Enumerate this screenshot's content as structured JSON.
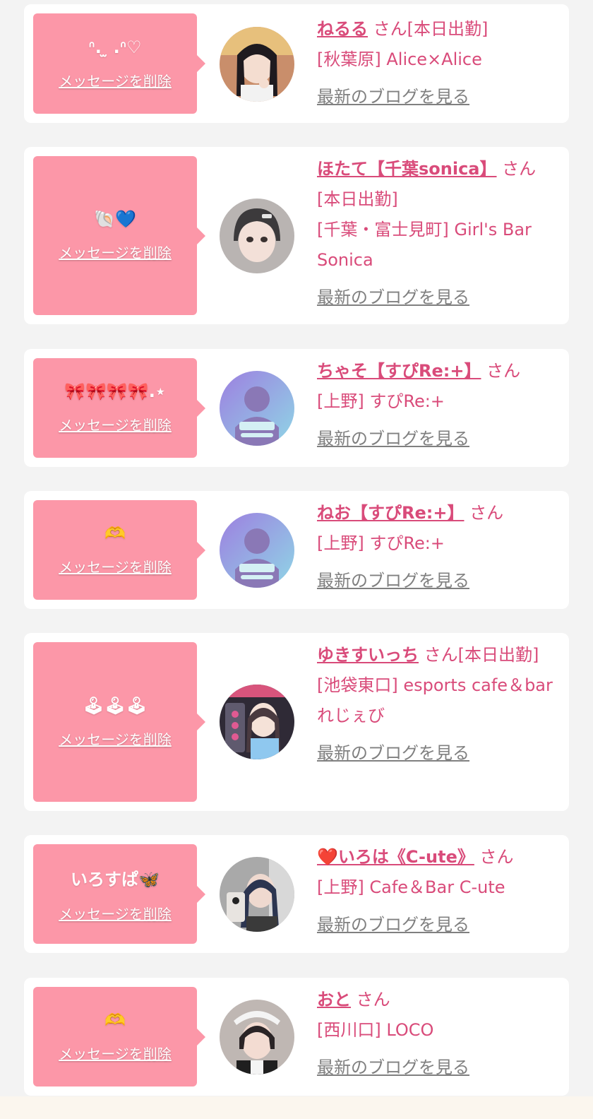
{
  "delete_label": "メッセージを削除",
  "blog_label": "最新のブログを見る",
  "items": [
    {
      "message": "ᐢ. ̫ .ᐢ♡",
      "name": "ねるる",
      "suffix": "さん[本日出勤]",
      "shop": "[秋葉原] Alice×Alice",
      "avatar": "photo"
    },
    {
      "message": "🐚💙",
      "name": "ほたて【千葉sonica】",
      "suffix": "さん[本日出勤]",
      "shop": "[千葉・富士見町] Girl's Bar Sonica",
      "avatar": "photo"
    },
    {
      "message": "🎀🎀🎀🎀.⋆",
      "name": "ちゃそ【すぴRe:+】",
      "suffix": "さん",
      "shop": "[上野] すぴRe:+",
      "avatar": "placeholder"
    },
    {
      "message": "🫶",
      "name": "ねお【すぴRe:+】",
      "suffix": "さん",
      "shop": "[上野] すぴRe:+",
      "avatar": "placeholder"
    },
    {
      "message": "🕹🕹🕹",
      "name": "ゆきすいっち",
      "suffix": "さん[本日出勤]",
      "shop": "[池袋東口] esports cafe＆bar れじぇび",
      "avatar": "photo"
    },
    {
      "message": "いろすぱ🦋",
      "name": "❤️いろは《C-ute》",
      "suffix": "さん",
      "shop": "[上野] Cafe＆Bar C-ute",
      "avatar": "photo"
    },
    {
      "message": "🫶",
      "name": "おと",
      "suffix": "さん",
      "shop": "[西川口] LOCO",
      "avatar": "photo"
    }
  ]
}
